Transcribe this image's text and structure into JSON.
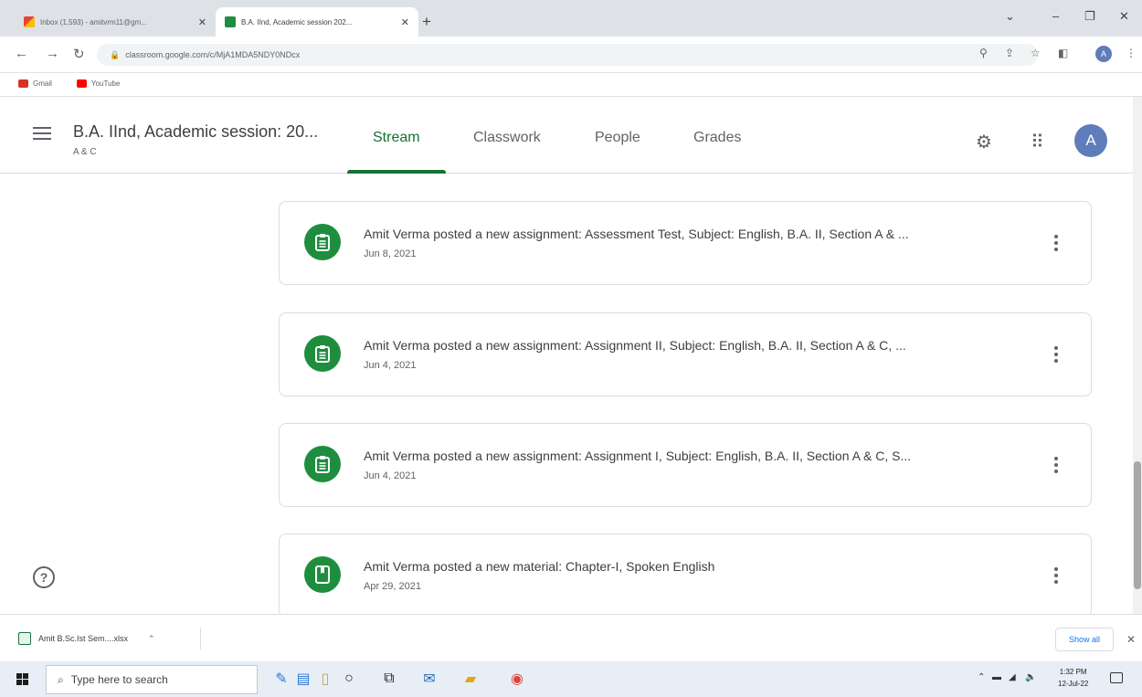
{
  "browser": {
    "tabs": [
      {
        "title": "Inbox (1,593) - amitvrm11@gm...",
        "favicon": "gmail-icon",
        "active": false
      },
      {
        "title": "B.A. IInd, Academic session 202...",
        "favicon": "classroom-icon",
        "active": true
      }
    ],
    "url": "classroom.google.com/c/MjA1MDA5NDY0NDcx",
    "bookmarks": [
      {
        "label": "Gmail",
        "icon": "gmail-icon",
        "color": "#d93025"
      },
      {
        "label": "YouTube",
        "icon": "youtube-icon",
        "color": "#ff0000"
      }
    ],
    "profile_initial": "A"
  },
  "classroom": {
    "class_title": "B.A. IInd, Academic session: 20...",
    "class_section": "A & C",
    "tabs": [
      "Stream",
      "Classwork",
      "People",
      "Grades"
    ],
    "active_tab": "Stream",
    "avatar_initial": "A",
    "accent_color": "#137333"
  },
  "stream": {
    "posts": [
      {
        "text": "Amit Verma posted a new assignment: Assessment Test, Subject: English, B.A. II, Section A & ...",
        "date": "Jun 8, 2021",
        "type": "assignment"
      },
      {
        "text": "Amit Verma posted a new assignment: Assignment II, Subject: English, B.A. II, Section A & C, ...",
        "date": "Jun 4, 2021",
        "type": "assignment"
      },
      {
        "text": "Amit Verma posted a new assignment: Assignment I, Subject: English, B.A. II, Section A & C, S...",
        "date": "Jun 4, 2021",
        "type": "assignment"
      },
      {
        "text": "Amit Verma posted a new material: Chapter-I, Spoken English",
        "date": "Apr 29, 2021",
        "type": "material"
      }
    ]
  },
  "downloads": {
    "file": "Amit B.Sc.Ist Sem....xlsx",
    "show_all": "Show all"
  },
  "taskbar": {
    "search_placeholder": "Type here to search",
    "time": "1:32 PM",
    "date": "12-Jul-22"
  }
}
